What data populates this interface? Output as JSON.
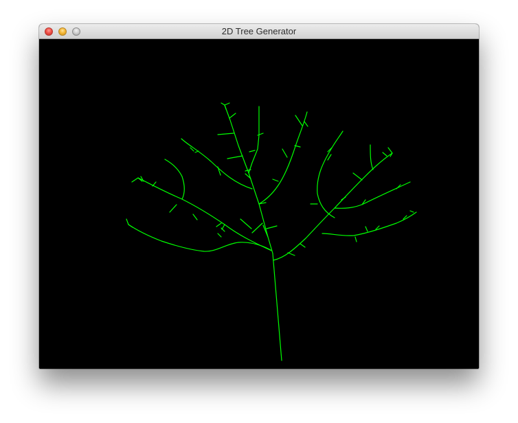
{
  "window": {
    "title": "2D Tree Generator",
    "buttons": [
      "close",
      "minimize",
      "zoom"
    ]
  },
  "canvas": {
    "background_color": "#000000",
    "stroke_color": "#00ff00",
    "drawing": "tree"
  }
}
